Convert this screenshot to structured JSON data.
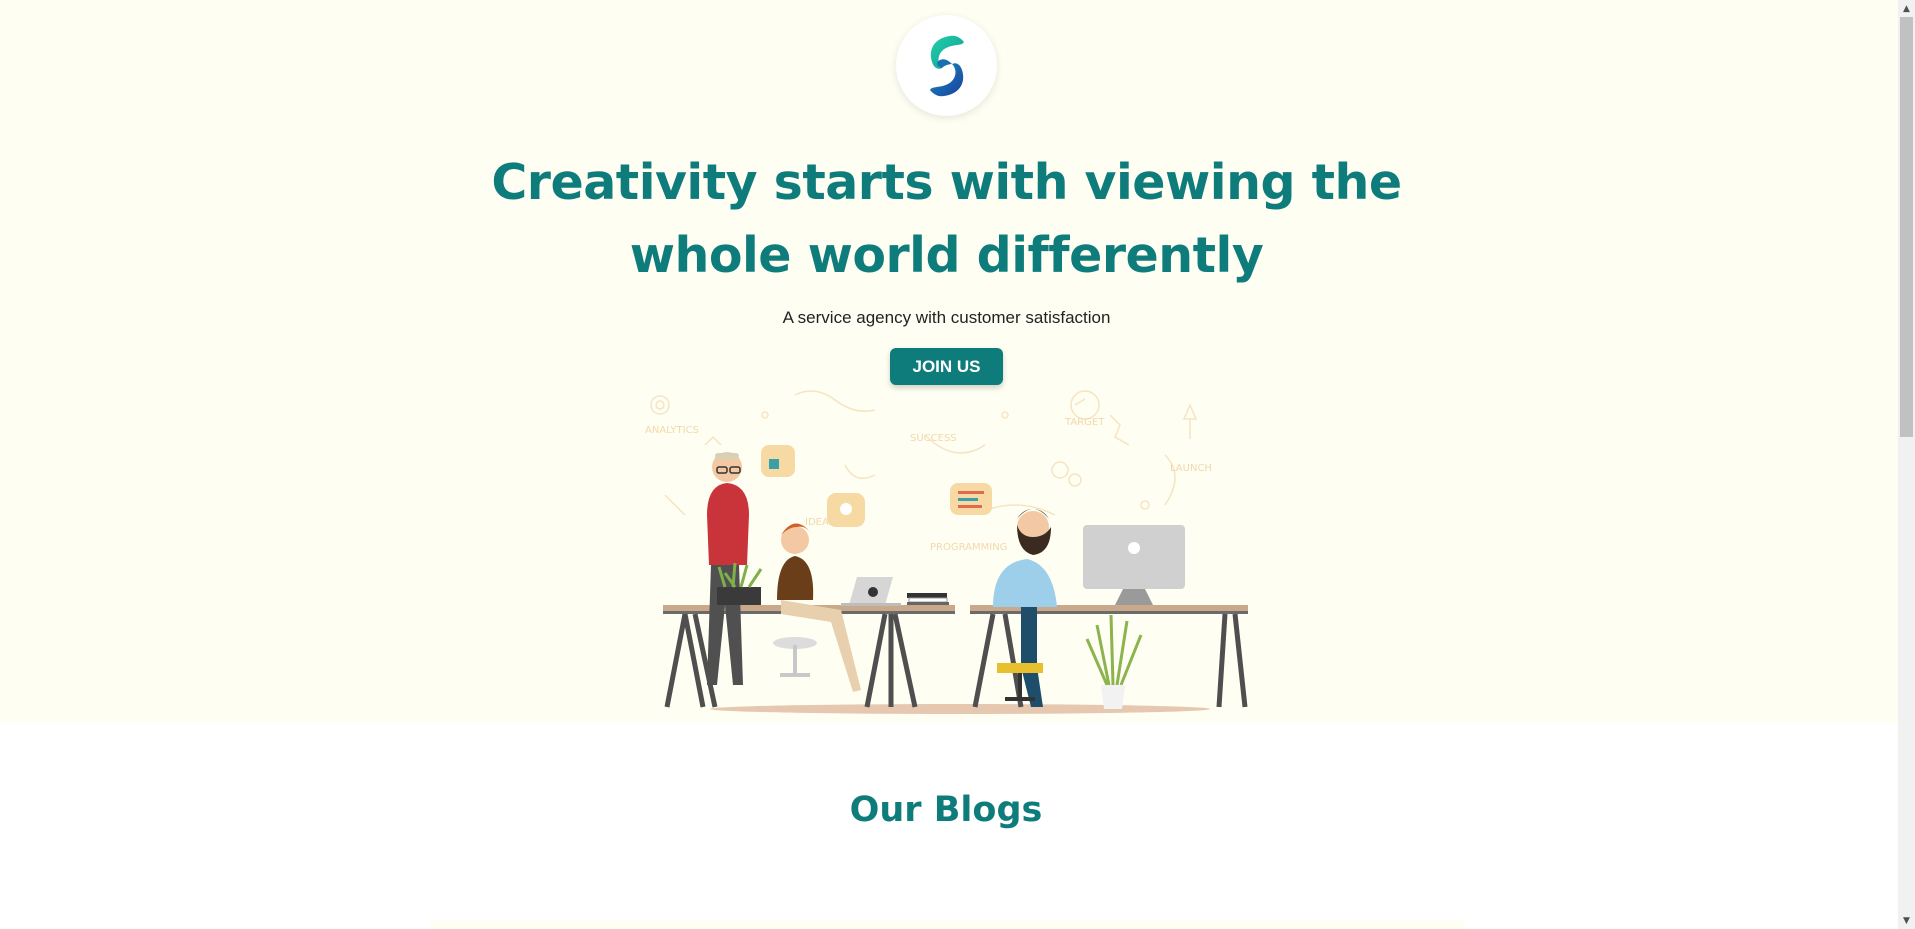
{
  "hero": {
    "headline": "Creativity starts with viewing the whole world differently",
    "subline": "A service agency with customer satisfaction",
    "cta_label": "JOIN US",
    "illustration_words": [
      "ANALYTICS",
      "SUCCESS",
      "TARGET",
      "LAUNCH",
      "PROGRAMMING",
      "IDEAS"
    ]
  },
  "blogs": {
    "title": "Our Blogs"
  },
  "scrollbar": {
    "up_icon": "▲",
    "down_icon": "▼"
  },
  "colors": {
    "brand": "#0f7c7c",
    "hero_bg": "#fefef3",
    "logo_gradient_start": "#1fc7a5",
    "logo_gradient_end": "#1d4fb8"
  }
}
